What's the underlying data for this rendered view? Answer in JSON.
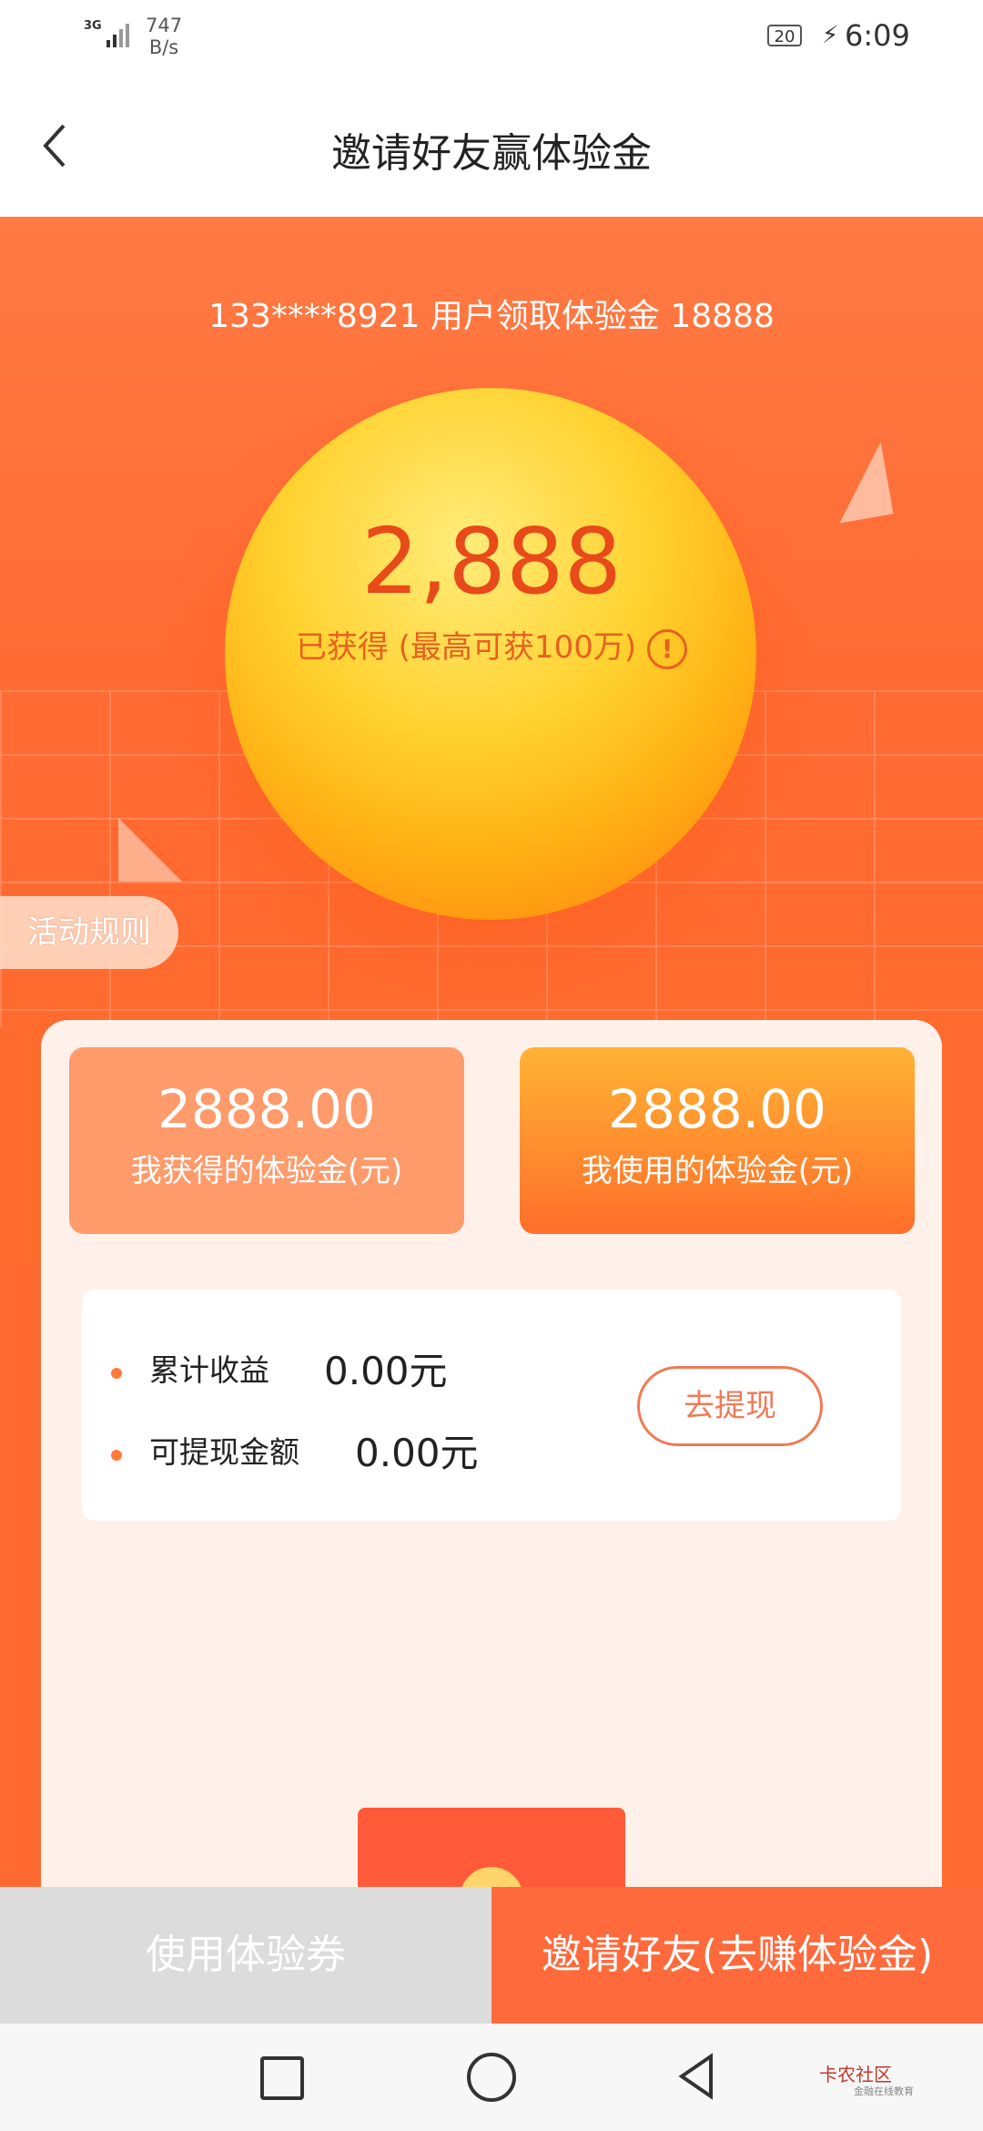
{
  "status": {
    "network": "3G",
    "speed_value": "747",
    "speed_unit": "B/s",
    "battery": "20",
    "time": "6:09"
  },
  "header": {
    "title": "邀请好友赢体验金"
  },
  "hero": {
    "ticker": "133****8921 用户领取体验金 18888",
    "amount": "2,888",
    "subtitle": "已获得 (最高可获100万)",
    "info_symbol": "!",
    "rules_label": "活动规则"
  },
  "cards": [
    {
      "value": "2888.00",
      "label": "我获得的体验金(元)"
    },
    {
      "value": "2888.00",
      "label": "我使用的体验金(元)"
    }
  ],
  "stats": {
    "items": [
      {
        "label": "累计收益",
        "value": "0.00元"
      },
      {
        "label": "可提现金额",
        "value": "0.00元"
      }
    ],
    "withdraw_label": "去提现"
  },
  "bottom": {
    "left_label": "使用体验券",
    "right_label": "邀请好友(去赚体验金)"
  },
  "watermark": {
    "name": "卡农社区",
    "sub": "金融在线教育"
  },
  "colors": {
    "accent": "#ff6a30",
    "button_right": "#ff6a3c",
    "button_left": "#dcdcdc"
  }
}
